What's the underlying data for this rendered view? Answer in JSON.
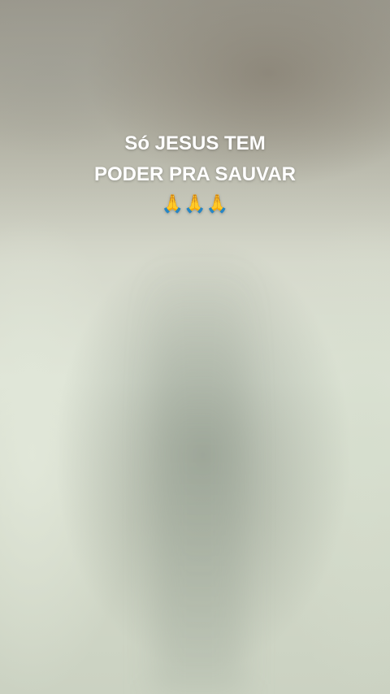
{
  "story": {
    "caption": {
      "line1": "Só JESUS TEM",
      "line2": "PODER PRA SAUVAR",
      "emojis": "🙏🙏🙏"
    },
    "background": {
      "tone_top": "#a7a498",
      "tone_middle": "#dde3d5",
      "tone_bottom": "#cbd2c2"
    }
  }
}
